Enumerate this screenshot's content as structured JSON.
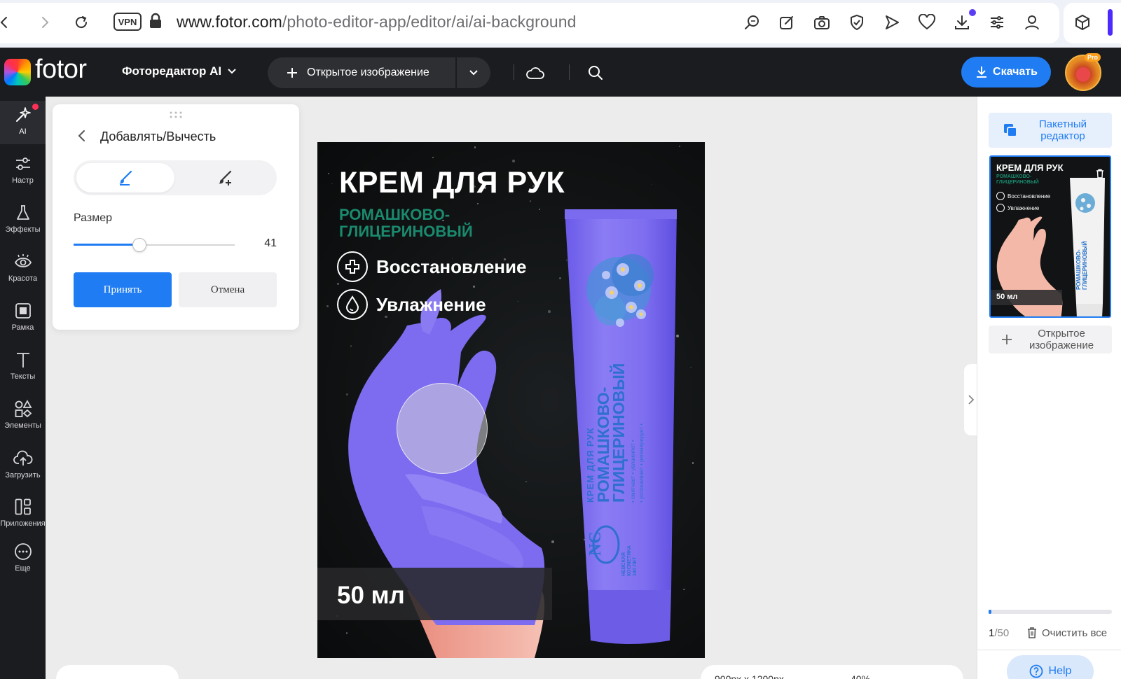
{
  "browser": {
    "url_host": "www.fotor.com",
    "url_path": "/photo-editor-app/editor/ai/ai-background",
    "vpn_label": "VPN",
    "icons": [
      "back-icon",
      "forward-icon",
      "reload-icon",
      "lock-icon",
      "search-page-icon",
      "edit-icon",
      "camera-icon",
      "shield-icon",
      "send-icon",
      "heart-icon",
      "download-icon",
      "sliders-icon",
      "profile-icon",
      "extension-icon"
    ]
  },
  "header": {
    "logo": "fotor",
    "editor_name": "Фоторедактор AI",
    "open_image": "Открытое изображение",
    "download": "Скачать",
    "pro_badge": "Pro"
  },
  "sidebar": {
    "items": [
      {
        "label": "AI",
        "icon": "ai-sparkle-icon"
      },
      {
        "label": "Настр",
        "icon": "adjust-icon"
      },
      {
        "label": "Эффекты",
        "icon": "effects-icon"
      },
      {
        "label": "Красота",
        "icon": "beauty-eye-icon"
      },
      {
        "label": "Рамка",
        "icon": "frame-icon"
      },
      {
        "label": "Тексты",
        "icon": "text-icon"
      },
      {
        "label": "Элементы",
        "icon": "elements-icon"
      },
      {
        "label": "Загрузить",
        "icon": "upload-icon"
      },
      {
        "label": "Приложения",
        "icon": "apps-icon"
      },
      {
        "label": "Еще",
        "icon": "more-icon"
      }
    ]
  },
  "tool_panel": {
    "title": "Добавлять/Вычесть",
    "size_label": "Размер",
    "size_value": "41",
    "size_fraction": 0.41,
    "accept": "Принять",
    "cancel": "Отмена"
  },
  "canvas": {
    "title": "КРЕМ ДЛЯ РУК",
    "subtitle": "РОМАШКОВО-ГЛИЦЕРИНОВЫЙ",
    "feature_1": "Восстановление",
    "feature_2": "Увлажнение",
    "volume": "50 мл",
    "tube_small": "КРЕМ ДЛЯ РУК",
    "tube_big_1": "РОМАШКОВО-",
    "tube_big_2": "ГЛИЦЕРИНОВЫЙ",
    "tube_claims_1": "• смягчает • увлажняет •",
    "tube_claims_2": "• успокаивает • регенерирует •",
    "tube_logo": "NC",
    "tube_brand_1": "НЕВСКАЯ",
    "tube_brand_2": "КОСМЕТИКА",
    "tube_brand_3": "180 ЛЕТ",
    "colors": {
      "accent_blue": "#1f7cf2",
      "mask_purple": "#7d6cf0",
      "subtitle_green": "#1a8a6e"
    }
  },
  "right_panel": {
    "batch": "Пакетный редактор",
    "thumb_title": "КРЕМ ДЛЯ РУК",
    "thumb_sub": "РОМАШКОВО-ГЛИЦЕРИНОВЫЙ",
    "thumb_f1": "Восстановление",
    "thumb_f2": "Увлажнение",
    "thumb_vol": "50 мл",
    "open_image": "Открытое изображение",
    "counter_current": "1",
    "counter_total": "/50",
    "clear_all": "Очистить все",
    "help": "Help"
  },
  "bottom": {
    "dimensions": "900px x 1200px",
    "zoom": "40%"
  }
}
